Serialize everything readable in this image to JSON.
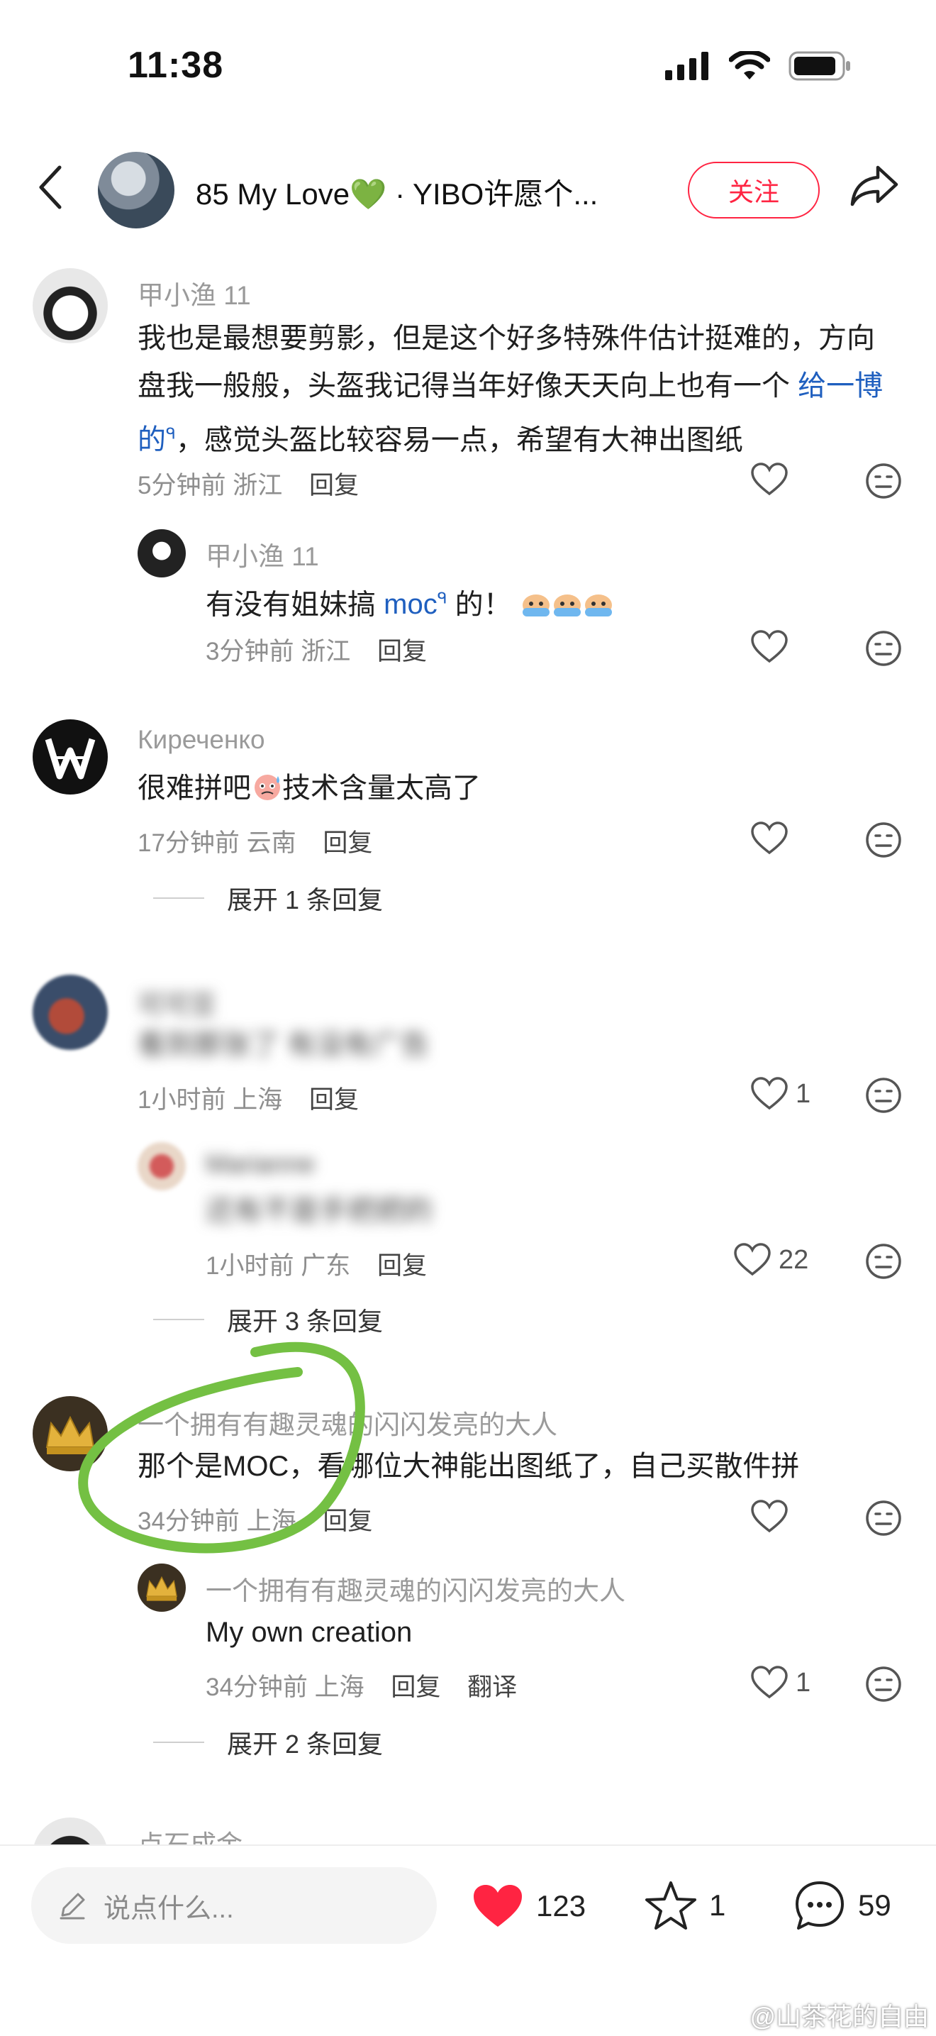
{
  "status_bar": {
    "time": "11:38"
  },
  "header": {
    "title": "85 My Love💚 · YIBO许愿个...",
    "follow_label": "关注"
  },
  "comments": [
    {
      "name": "甲小渔 11",
      "text_part1": "我也是最想要剪影，但是这个好多特殊件估计挺难的，方向盘我一般般，头盔我记得当年好像天天向上也有一个",
      "link": "给一博的",
      "text_part2": "，感觉头盔比较容易一点，希望有大神出图纸",
      "time": "5分钟前",
      "location": "浙江",
      "reply_label": "回复"
    },
    {
      "name": "甲小渔 11",
      "text_prefix": "有没有姐妹搞 ",
      "link": "moc",
      "text_suffix": " 的！",
      "time": "3分钟前",
      "location": "浙江",
      "reply_label": "回复"
    },
    {
      "name": "Киреченко",
      "text_prefix": "很难拼吧",
      "text_suffix": "技术含量太高了",
      "time": "17分钟前",
      "location": "云南",
      "reply_label": "回复",
      "expand": "展开 1 条回复"
    },
    {
      "name": "可可豆",
      "text": "看到那张了 有没有广告",
      "time": "1小时前",
      "location": "上海",
      "reply_label": "回复",
      "likes": "1"
    },
    {
      "name": "Marianne",
      "text": "还有不是手把把的",
      "time": "1小时前",
      "location": "广东",
      "reply_label": "回复",
      "likes": "22",
      "expand": "展开 3 条回复"
    },
    {
      "name": "一个拥有有趣灵魂的闪闪发亮的大人",
      "text": "那个是MOC，看哪位大神能出图纸了，自己买散件拼",
      "time": "34分钟前",
      "location": "上海",
      "reply_label": "回复"
    },
    {
      "name": "一个拥有有趣灵魂的闪闪发亮的大人",
      "text": "My own creation",
      "time": "34分钟前",
      "location": "上海",
      "reply_label": "回复",
      "translate_label": "翻译",
      "likes": "1",
      "expand": "展开 2 条回复"
    },
    {
      "name": "点石成金"
    }
  ],
  "bottom_bar": {
    "input_placeholder": "说点什么...",
    "likes": "123",
    "stars": "1",
    "comments": "59"
  },
  "watermark": "@山茶花的自由",
  "colors": {
    "accent": "#ff2442",
    "link": "#1f5fbf",
    "annotation": "#74c043"
  }
}
